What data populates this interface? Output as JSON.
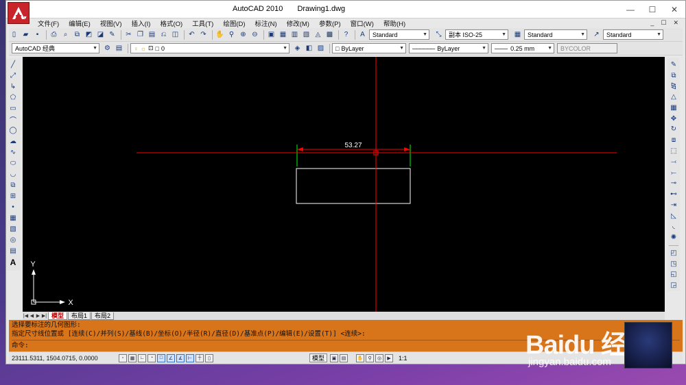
{
  "window": {
    "app_name": "AutoCAD 2010",
    "document": "Drawing1.dwg",
    "controls": [
      "—",
      "☐",
      "✕"
    ]
  },
  "menu": [
    "文件(F)",
    "编辑(E)",
    "视图(V)",
    "插入(I)",
    "格式(O)",
    "工具(T)",
    "绘图(D)",
    "标注(N)",
    "修改(M)",
    "参数(P)",
    "窗口(W)",
    "帮助(H)"
  ],
  "mdi_controls": [
    "_",
    "☐",
    "✕"
  ],
  "styles_toolbar": {
    "text_style": "Standard",
    "dim_style": "副本 ISO-25",
    "table_style": "Standard",
    "mleader_style": "Standard"
  },
  "workspace": "AutoCAD 经典",
  "layer": {
    "name": "0"
  },
  "properties": {
    "color": "ByLayer",
    "linetype": "ByLayer",
    "lineweight": "0.25 mm",
    "plotstyle": "BYCOLOR"
  },
  "canvas": {
    "dimension_text": "53.27",
    "ucs_x": "X",
    "ucs_y": "Y",
    "crosshair_color": "#ff0000",
    "geometry_color": "#ffffff",
    "dim_color": "#ff0000",
    "extension_color": "#00ff00",
    "rect_width_units": 53.27
  },
  "layout_tabs": [
    "模型",
    "布局1",
    "布局2"
  ],
  "command": {
    "history": [
      "选择要标注的几何图形:",
      "指定尺寸线位置或 [连续(C)/并列(S)/基线(B)/坐标(O)/半径(R)/直径(D)/基准点(P)/编辑(E)/设置(T)] <连续>:"
    ],
    "prompt": "命令:"
  },
  "status": {
    "coordinates": "23111.5311, 1504.0715, 0.0000",
    "model_label": "模型",
    "annotation_scale": "1:1"
  },
  "watermark": {
    "brand": "Baidu 经验",
    "url": "jingyan.baidu.com"
  },
  "colors": {
    "command_bg": "#d8741a",
    "app_button": "#c8242b"
  }
}
